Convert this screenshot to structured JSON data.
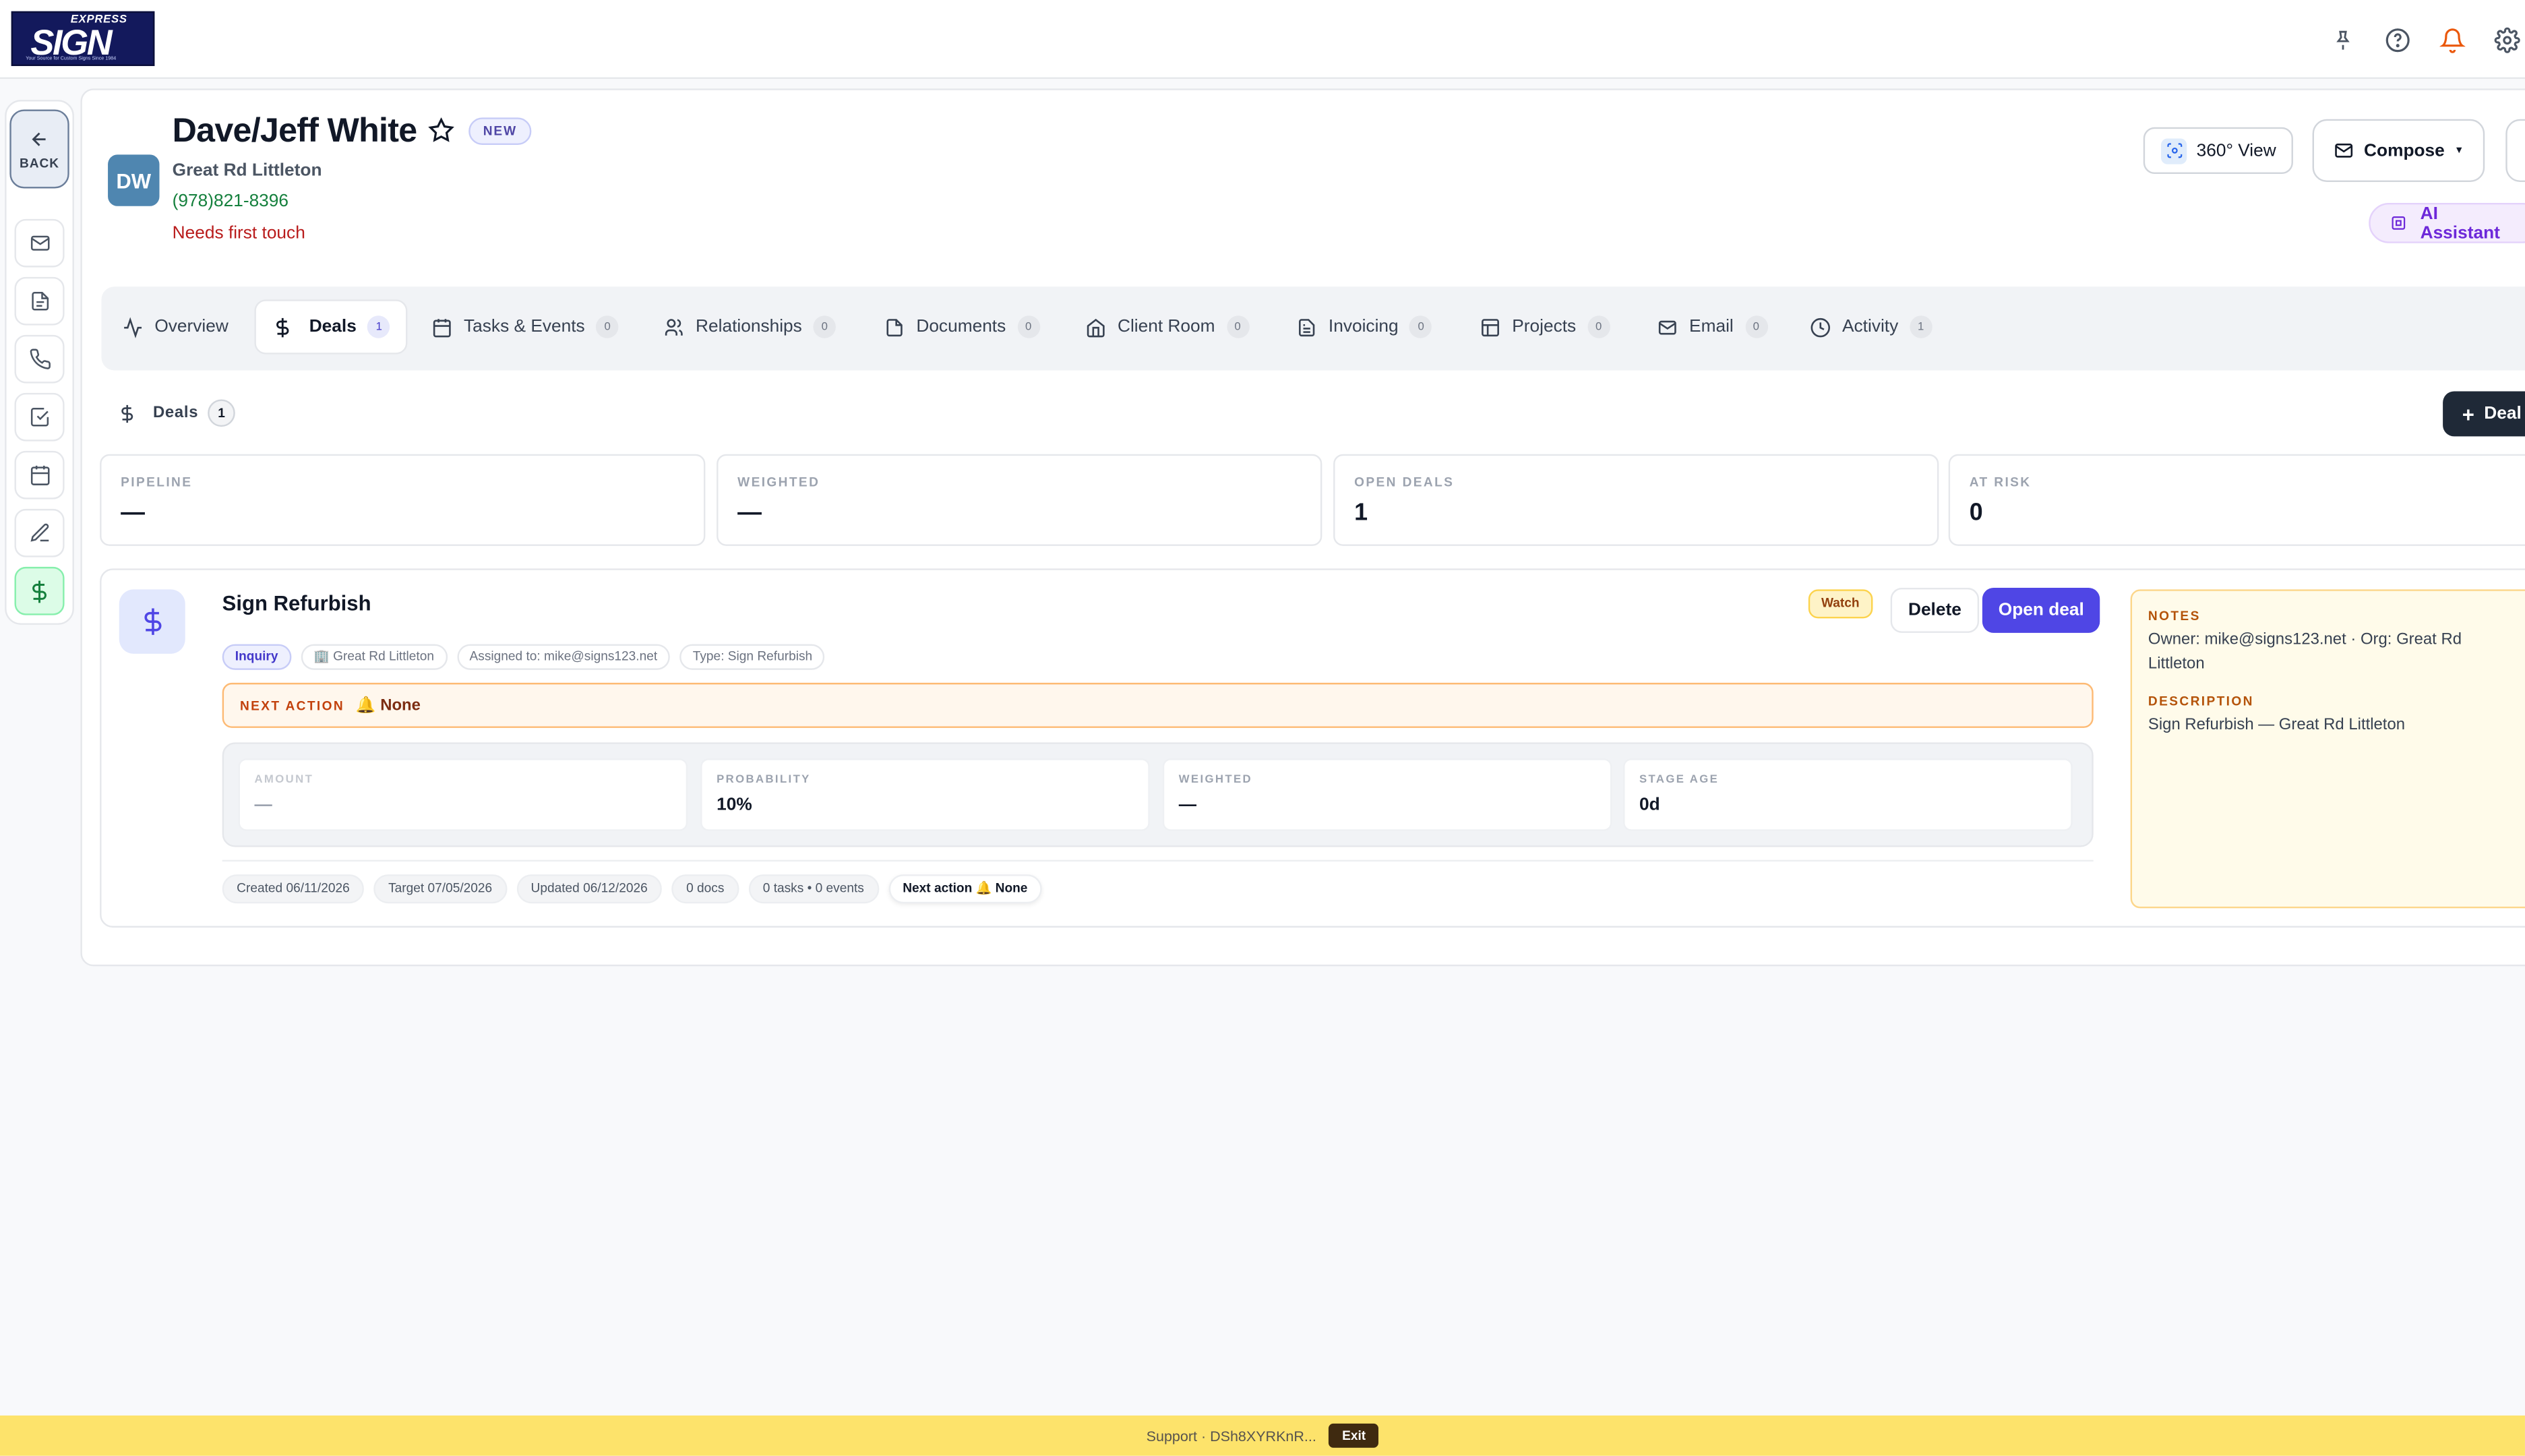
{
  "app": {
    "logo": {
      "brand_top": "EXPRESS",
      "brand_main": "SIGN",
      "tagline": "Your Source for Custom Signs Since 1984"
    }
  },
  "topbar": {
    "icons": [
      "pin-icon",
      "help-icon",
      "bell-icon",
      "gear-icon"
    ]
  },
  "siderail": {
    "back_label": "BACK",
    "items": [
      "mail-icon",
      "document-icon",
      "phone-icon",
      "check-square-icon",
      "calendar-icon",
      "pen-icon",
      "dollar-icon"
    ],
    "active_item": "dollar-icon"
  },
  "contact": {
    "initials": "DW",
    "name": "Dave/Jeff White",
    "badge": "NEW",
    "org": "Great Rd Littleton",
    "phone": "(978)821-8396",
    "status": "Needs first touch"
  },
  "header_actions": {
    "view_label": "360° View",
    "compose_label": "Compose",
    "ai_label": "AI Assistant"
  },
  "tabs": [
    {
      "label": "Overview",
      "count": "",
      "icon": "activity-icon"
    },
    {
      "label": "Deals",
      "count": "1",
      "icon": "dollar-icon",
      "active": true
    },
    {
      "label": "Tasks & Events",
      "count": "0",
      "icon": "calendar-icon"
    },
    {
      "label": "Relationships",
      "count": "0",
      "icon": "users-icon"
    },
    {
      "label": "Documents",
      "count": "0",
      "icon": "file-icon"
    },
    {
      "label": "Client Room",
      "count": "0",
      "icon": "home-icon"
    },
    {
      "label": "Invoicing",
      "count": "0",
      "icon": "invoice-icon"
    },
    {
      "label": "Projects",
      "count": "0",
      "icon": "layout-icon"
    },
    {
      "label": "Email",
      "count": "0",
      "icon": "mail-icon"
    },
    {
      "label": "Activity",
      "count": "1",
      "icon": "clock-icon"
    }
  ],
  "deals_section": {
    "title": "Deals",
    "count": "1",
    "new_deal_label": "Deal"
  },
  "stats": [
    {
      "label": "PIPELINE",
      "value": "—"
    },
    {
      "label": "WEIGHTED",
      "value": "—"
    },
    {
      "label": "OPEN DEALS",
      "value": "1"
    },
    {
      "label": "AT RISK",
      "value": "0"
    }
  ],
  "deal": {
    "title": "Sign Refurbish",
    "watch_label": "Watch",
    "delete_label": "Delete",
    "open_label": "Open deal",
    "chips": {
      "stage": "Inquiry",
      "org": "🏢 Great Rd Littleton",
      "assigned": "Assigned to: mike@signs123.net",
      "type": "Type: Sign Refurbish"
    },
    "next_action": {
      "label": "NEXT ACTION",
      "value": "🔔 None"
    },
    "metrics": [
      {
        "label": "AMOUNT",
        "value": "—"
      },
      {
        "label": "PROBABILITY",
        "value": "10%"
      },
      {
        "label": "WEIGHTED",
        "value": "—"
      },
      {
        "label": "STAGE AGE",
        "value": "0d"
      }
    ],
    "footer": {
      "created": "Created 06/11/2026",
      "target": "Target 07/05/2026",
      "updated": "Updated 06/12/2026",
      "docs": "0 docs",
      "tasks": "0 tasks • 0 events",
      "next": "Next action 🔔 None"
    },
    "notes": {
      "notes_label": "NOTES",
      "notes_text": "Owner: mike@signs123.net · Org: Great Rd Littleton",
      "description_label": "DESCRIPTION",
      "description_text": "Sign Refurbish — Great Rd Littleton"
    }
  },
  "support_bar": {
    "text": "Support · DSh8XYRKnR...",
    "exit_label": "Exit"
  }
}
